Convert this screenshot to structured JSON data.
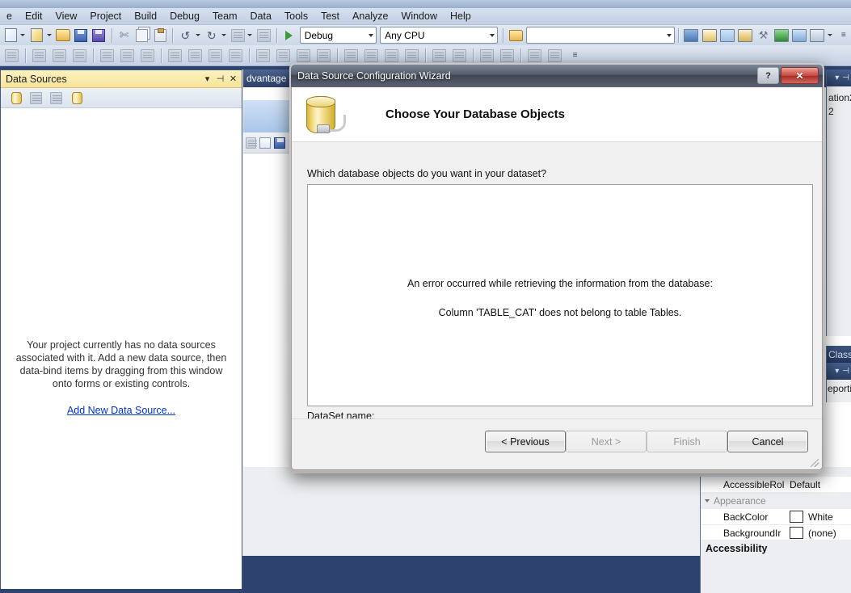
{
  "app": {
    "menu": [
      "e",
      "Edit",
      "View",
      "Project",
      "Build",
      "Debug",
      "Team",
      "Data",
      "Tools",
      "Test",
      "Analyze",
      "Window",
      "Help"
    ],
    "toolbar": {
      "configuration": "Debug",
      "platform": "Any CPU",
      "find_placeholder": "",
      "find_value": "",
      "icons": [
        "new-project-icon",
        "new-item-icon",
        "open-file-icon",
        "save-icon",
        "save-all-icon",
        "cut-icon",
        "copy-icon",
        "paste-icon",
        "undo-icon",
        "redo-icon",
        "comment-icon",
        "uncomment-icon",
        "start-debugging-icon",
        "find-in-files-icon",
        "solution-explorer-icon",
        "properties-window-icon",
        "object-browser-icon",
        "toolbox-icon",
        "error-list-icon",
        "navigate-forward-icon",
        "new-window-icon",
        "command-window-icon"
      ],
      "layout_icons": [
        "align-lefts-icon",
        "align-centers-icon",
        "align-rights-icon",
        "align-tops-icon",
        "align-middles-icon",
        "align-bottoms-icon",
        "make-same-width-icon",
        "make-same-height-icon",
        "make-same-size-icon",
        "size-to-grid-icon",
        "horizontal-spacing-make-equal-icon",
        "horizontal-spacing-increase-icon",
        "horizontal-spacing-decrease-icon",
        "horizontal-spacing-remove-icon",
        "vertical-spacing-make-equal-icon",
        "vertical-spacing-increase-icon",
        "vertical-spacing-decrease-icon",
        "vertical-spacing-remove-icon",
        "center-horizontally-icon",
        "center-vertically-icon",
        "bring-to-front-icon",
        "send-to-back-icon",
        "tab-order-icon",
        "lock-controls-icon"
      ]
    }
  },
  "data_sources_panel": {
    "title": "Data Sources",
    "window_buttons": [
      "chevron-down-icon",
      "pin-icon",
      "close-icon"
    ],
    "toolbar_icons": [
      "add-new-data-source-icon",
      "configure-dataset-icon",
      "edit-dataset-icon",
      "refresh-icon"
    ],
    "empty_message": "Your project currently has no data sources associated with it. Add a new data source, then data-bind items by dragging from this window onto forms or existing controls.",
    "link": "Add New Data Source..."
  },
  "editor": {
    "document_tab": "dvantage"
  },
  "right_panels": {
    "solution_explorer_line1": "ation2",
    "solution_explorer_line2": "2",
    "class_view_tab": "Class",
    "reporting_label": "eporti"
  },
  "properties": {
    "rows": [
      {
        "name": "AccessibleRol",
        "value": "Default",
        "swatch": null,
        "category": false
      },
      {
        "name": "Appearance",
        "value": "",
        "swatch": null,
        "category": true
      },
      {
        "name": "BackColor",
        "value": "White",
        "swatch": "#ffffff",
        "category": false
      },
      {
        "name": "BackgroundIr",
        "value": "(none)",
        "swatch": "#ffffff",
        "category": false
      }
    ],
    "footer_heading": "Accessibility"
  },
  "dialog": {
    "title": "Data Source Configuration Wizard",
    "titlebar_buttons": {
      "help": "?",
      "close": "✕"
    },
    "heading": "Choose Your Database Objects",
    "heading_icon": "database-with-plug-icon",
    "question": "Which database objects do you want in your dataset?",
    "error_line1": "An error occurred while retrieving the information from the database:",
    "error_line2": "Column 'TABLE_CAT' does not belong to table Tables.",
    "dataset_label": "DataSet name:",
    "dataset_value": "",
    "buttons": [
      {
        "label": "< Previous",
        "state": "enabled"
      },
      {
        "label": "Next >",
        "state": "disabled"
      },
      {
        "label": "Finish",
        "state": "disabled"
      },
      {
        "label": "Cancel",
        "state": "enabled"
      }
    ]
  },
  "colors": {
    "desktop": "#2e4270",
    "panel_title": "#f7e49a",
    "link": "#0033cc",
    "close_button": "#c6453c",
    "db_icon": "#f0d878"
  }
}
